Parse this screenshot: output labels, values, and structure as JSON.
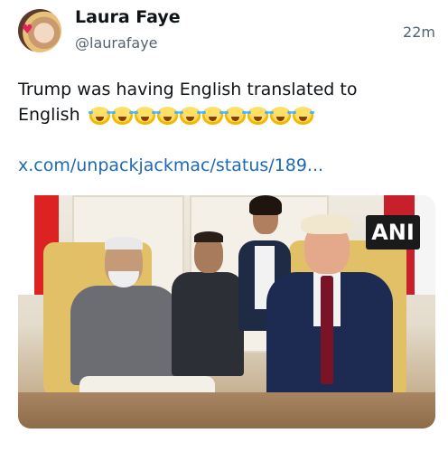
{
  "post": {
    "author_name": "Laura Faye",
    "author_handle": "@laurafaye",
    "timestamp": "22m",
    "text": "Trump was having English translated to English",
    "emoji_count": 10,
    "link_text": "x.com/unpackjackmac/status/189..."
  },
  "media": {
    "watermark": "ANI"
  },
  "colors": {
    "link": "#1d6ab3",
    "secondary_text": "#536471",
    "primary_text": "#0f1419"
  }
}
